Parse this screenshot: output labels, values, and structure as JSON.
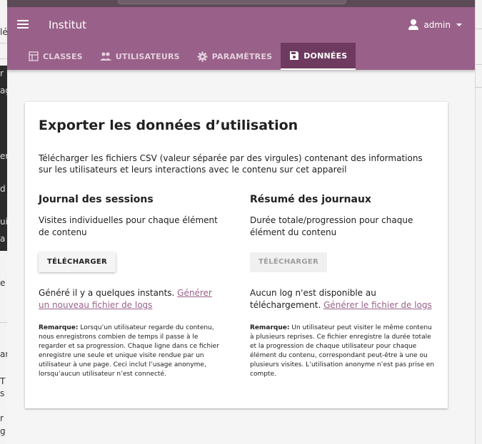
{
  "background": {
    "left_fragments": [
      "lé",
      "r",
      "ag",
      "er",
      "d",
      "ui",
      "a",
      "e",
      "ar",
      "T",
      "s",
      "r",
      "g"
    ]
  },
  "app": {
    "title": "Institut",
    "user": "admin",
    "colors": {
      "brand": "#996189",
      "active_tab": "#6e3a5f",
      "link": "#996189"
    },
    "tabs": [
      {
        "label": "CLASSES",
        "icon": "classes-icon",
        "active": false
      },
      {
        "label": "UTILISATEURS",
        "icon": "people-icon",
        "active": false
      },
      {
        "label": "PARAMÈTRES",
        "icon": "gear-icon",
        "active": false
      },
      {
        "label": "DONNÉES",
        "icon": "save-icon",
        "active": true
      }
    ]
  },
  "card": {
    "title": "Exporter les données d’utilisation",
    "description": "Télécharger les fichiers CSV (valeur séparée par des virgules) contenant des informations sur les utilisateurs et leurs interactions avec le contenu sur cet appareil",
    "sessions": {
      "heading": "Journal des sessions",
      "description": "Visites individuelles pour chaque élément de contenu",
      "button": "TÉLÉCHARGER",
      "status_text": "Généré il y a quelques instants.",
      "status_link": "Générer un nouveau fichier de logs",
      "note_label": "Remarque:",
      "note_text": "Lorsqu’un utilisateur regarde du contenu, nous enregistrons combien de temps il passe à le regarder et sa progression. Chaque ligne dans ce fichier enregistre une seule et unique visite rendue par un utilisateur à une page. Ceci inclut l’usage anonyme, lorsqu’aucun utilisateur n’est connecté."
    },
    "summary": {
      "heading": "Résumé des journaux",
      "description": "Durée totale/progression pour chaque élément du contenu",
      "button": "TÉLÉCHARGER",
      "status_text": "Aucun log n'est disponible au téléchargement.",
      "status_link": "Générer le fichier de logs",
      "note_label": "Remarque:",
      "note_text": "Un utilisateur peut visiter le même contenu à plusieurs reprises. Ce fichier enregistre la durée totale et la progression de chaque utilisateur pour chaque élément du contenu, correspondant peut-être à une ou plusieurs visites. L’utilisation anonyme n’est pas prise en compte."
    }
  }
}
